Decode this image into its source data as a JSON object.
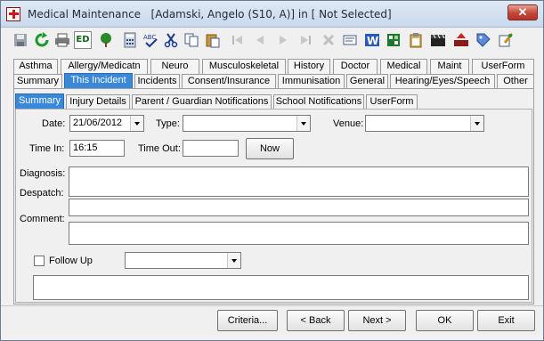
{
  "window": {
    "title": "Medical Maintenance",
    "subtitle": "[Adamski, Angelo (S10, A)] in [ Not Selected]",
    "close_glyph": "✕"
  },
  "toolbar": {
    "items": [
      "save-icon",
      "refresh-icon",
      "print-icon",
      "ed-icon",
      "tree-icon",
      "calculator-icon",
      "spellcheck-icon",
      "cut-icon",
      "copy-icon",
      "paste-icon",
      "first-icon",
      "prev-icon",
      "next-icon",
      "last-icon",
      "delete-icon",
      "message-icon",
      "word-icon",
      "grid-icon",
      "clipboard-icon",
      "clapper-icon",
      "export-icon",
      "tag-icon",
      "edit-icon"
    ],
    "ed_label": "ED"
  },
  "tabs_row1": [
    "Asthma",
    "Allergy/Medicatn",
    "Neuro",
    "Musculoskeletal",
    "History",
    "Doctor",
    "Medical",
    "Maint",
    "UserForm"
  ],
  "tabs_row2": [
    "Summary",
    "This Incident",
    "Incidents",
    "Consent/Insurance",
    "Immunisation",
    "General",
    "Hearing/Eyes/Speech",
    "Other"
  ],
  "tabs_row3": [
    "Summary",
    "Injury Details",
    "Parent / Guardian Notifications",
    "School Notifications",
    "UserForm"
  ],
  "form": {
    "date_label": "Date:",
    "date_value": "21/06/2012",
    "type_label": "Type:",
    "type_value": "",
    "venue_label": "Venue:",
    "venue_value": "",
    "time_in_label": "Time In:",
    "time_in_value": "16:15",
    "time_out_label": "Time Out:",
    "time_out_value": "",
    "now_label": "Now",
    "diagnosis_label": "Diagnosis:",
    "despatch_label": "Despatch:",
    "comment_label": "Comment:",
    "follow_up_label": "Follow Up",
    "follow_up_value": ""
  },
  "footer": {
    "criteria_label": "Criteria...",
    "back_label": "< Back",
    "next_label": "Next >",
    "ok_label": "OK",
    "exit_label": "Exit"
  }
}
